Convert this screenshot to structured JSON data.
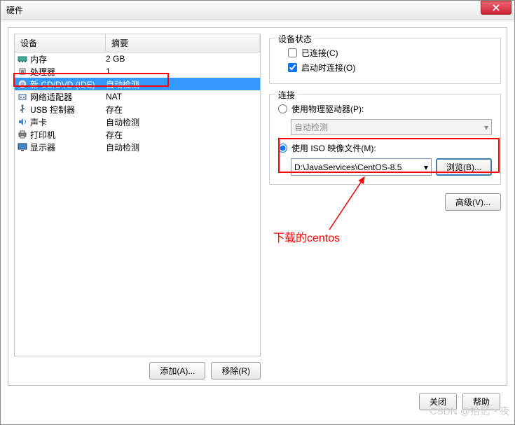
{
  "title": "硬件",
  "table": {
    "headers": {
      "device": "设备",
      "summary": "摘要"
    },
    "rows": [
      {
        "icon": "memory-icon",
        "device": "内存",
        "summary": "2 GB",
        "selected": false
      },
      {
        "icon": "cpu-icon",
        "device": "处理器",
        "summary": "1",
        "selected": false
      },
      {
        "icon": "cd-icon",
        "device": "新 CD/DVD (IDE)",
        "summary": "自动检测",
        "selected": true
      },
      {
        "icon": "network-icon",
        "device": "网络适配器",
        "summary": "NAT",
        "selected": false
      },
      {
        "icon": "usb-icon",
        "device": "USB 控制器",
        "summary": "存在",
        "selected": false
      },
      {
        "icon": "sound-icon",
        "device": "声卡",
        "summary": "自动检测",
        "selected": false
      },
      {
        "icon": "printer-icon",
        "device": "打印机",
        "summary": "存在",
        "selected": false
      },
      {
        "icon": "display-icon",
        "device": "显示器",
        "summary": "自动检测",
        "selected": false
      }
    ]
  },
  "buttons": {
    "add": "添加(A)...",
    "remove": "移除(R)",
    "close": "关闭",
    "help": "帮助",
    "browse": "浏览(B)...",
    "advanced": "高级(V)..."
  },
  "status_group": {
    "title": "设备状态",
    "connected": "已连接(C)",
    "connect_on_start": "启动时连接(O)",
    "connected_checked": false,
    "connect_on_start_checked": true
  },
  "connection_group": {
    "title": "连接",
    "use_physical": "使用物理驱动器(P):",
    "physical_value": "自动检测",
    "use_iso": "使用 ISO 映像文件(M):",
    "iso_path": "D:\\JavaServices\\CentOS-8.5",
    "selected": "iso"
  },
  "annotation": "下载的centos",
  "watermark": "CSDN @拾忆丶夜"
}
